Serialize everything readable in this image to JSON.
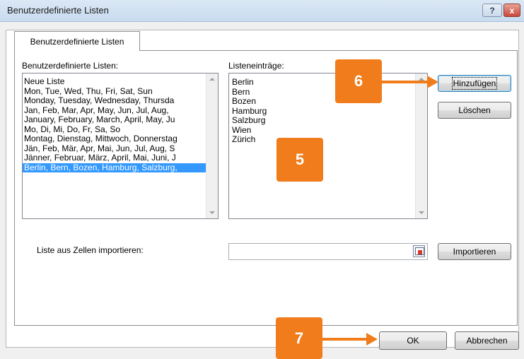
{
  "window": {
    "title": "Benutzerdefinierte Listen",
    "help_label": "?",
    "close_label": "x"
  },
  "tab": {
    "label": "Benutzerdefinierte Listen"
  },
  "lists": {
    "label": "Benutzerdefinierte Listen:",
    "items": [
      "Neue Liste",
      "Mon, Tue, Wed, Thu, Fri, Sat, Sun",
      "Monday, Tuesday, Wednesday, Thursda",
      "Jan, Feb, Mar, Apr, May, Jun, Jul, Aug,",
      "January, February, March, April, May, Ju",
      "Mo, Di, Mi, Do, Fr, Sa, So",
      "Montag, Dienstag, Mittwoch, Donnerstag",
      "Jän, Feb, Mär, Apr, Mai, Jun, Jul, Aug, S",
      "Jänner, Februar, März, April, Mai, Juni, J",
      "Berlin, Bern, Bozen, Hamburg, Salzburg,"
    ],
    "selected_index": 9
  },
  "entries": {
    "label": "Listeneinträge:",
    "items": [
      "Berlin",
      "Bern",
      "Bozen",
      "Hamburg",
      "Salzburg",
      "Wien",
      "Zürich"
    ]
  },
  "buttons": {
    "add": "Hinzufügen",
    "delete": "Löschen",
    "import": "Importieren",
    "ok": "OK",
    "cancel": "Abbrechen"
  },
  "import": {
    "label": "Liste aus Zellen importieren:",
    "value": ""
  },
  "callouts": {
    "add": "6",
    "entries": "5",
    "ok": "7"
  },
  "colors": {
    "callout": "#f07c1b",
    "selection": "#3399ff"
  }
}
